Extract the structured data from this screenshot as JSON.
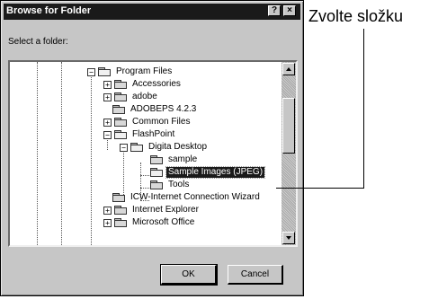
{
  "dialog": {
    "title": "Browse for Folder",
    "help_label": "?",
    "close_label": "×",
    "prompt": "Select a folder:",
    "ok_label": "OK",
    "cancel_label": "Cancel"
  },
  "tree": {
    "items": [
      {
        "label": "Program Files",
        "expander": "−"
      },
      {
        "label": "Accessories",
        "expander": "+"
      },
      {
        "label": "adobe",
        "expander": "+"
      },
      {
        "label": "ADOBEPS 4.2.3",
        "expander": ""
      },
      {
        "label": "Common Files",
        "expander": "+"
      },
      {
        "label": "FlashPoint",
        "expander": "−"
      },
      {
        "label": "Digita Desktop",
        "expander": "−"
      },
      {
        "label": "sample",
        "expander": ""
      },
      {
        "label": "Sample Images (JPEG)",
        "expander": "",
        "selected": true
      },
      {
        "label": "Tools",
        "expander": ""
      },
      {
        "label": "ICW-Internet Connection Wizard",
        "expander": ""
      },
      {
        "label": "Internet Explorer",
        "expander": "+"
      },
      {
        "label": "Microsoft Office",
        "expander": "+"
      }
    ]
  },
  "annotation": {
    "text": "Zvolte složku"
  }
}
